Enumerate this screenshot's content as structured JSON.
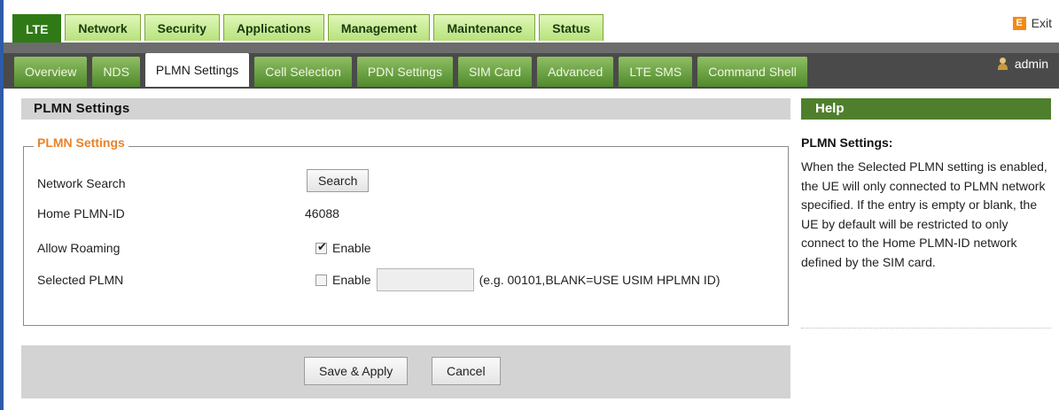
{
  "main_tabs": [
    "LTE",
    "Network",
    "Security",
    "Applications",
    "Management",
    "Maintenance",
    "Status"
  ],
  "sub_tabs": [
    "Overview",
    "NDS",
    "PLMN Settings",
    "Cell Selection",
    "PDN Settings",
    "SIM Card",
    "Advanced",
    "LTE SMS",
    "Command Shell"
  ],
  "header": {
    "exit_label": "Exit",
    "user": "admin"
  },
  "section": {
    "title": "PLMN Settings",
    "legend": "PLMN Settings"
  },
  "form": {
    "network_search_label": "Network Search",
    "search_button": "Search",
    "home_plmn_label": "Home PLMN-ID",
    "home_plmn_value": "46088",
    "allow_roaming_label": "Allow Roaming",
    "allow_roaming_enable": "Enable",
    "selected_plmn_label": "Selected PLMN",
    "selected_plmn_enable": "Enable",
    "selected_plmn_value": "",
    "selected_plmn_hint": "(e.g. 00101,BLANK=USE USIM HPLMN ID)"
  },
  "actions": {
    "save": "Save & Apply",
    "cancel": "Cancel"
  },
  "help": {
    "header": "Help",
    "title": "PLMN Settings:",
    "text": "When the Selected PLMN setting is enabled, the UE will only connected to PLMN network specified. If the entry is empty or blank, the UE by default will be restricted to only connect to the Home PLMN-ID network defined by the SIM card."
  },
  "colors": {
    "accent_green": "#2f7a16",
    "legend_orange": "#e9822a",
    "frame_blue": "#2d5ba8"
  },
  "icons": {
    "exit": "exit-icon",
    "user": "user-icon"
  }
}
